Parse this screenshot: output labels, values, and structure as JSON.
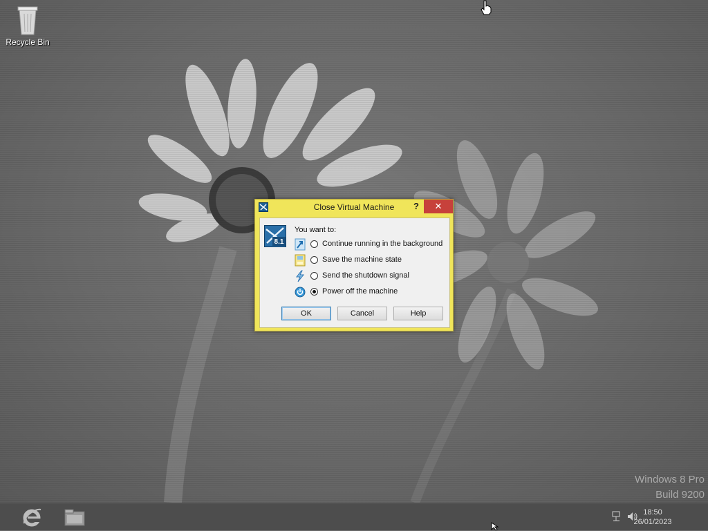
{
  "desktop": {
    "icons": [
      {
        "label": "Recycle Bin",
        "icon": "recycle-bin-icon"
      }
    ],
    "watermark": {
      "line1": "Windows 8 Pro",
      "line2": "Build 9200"
    }
  },
  "dialog": {
    "title": "Close Virtual Machine",
    "help_glyph": "?",
    "close_glyph": "✕",
    "logo_text": "8.1",
    "prompt": "You want to:",
    "options": [
      {
        "label": "Continue running in the background",
        "icon": "continue-running-icon",
        "checked": false
      },
      {
        "label": "Save the machine state",
        "icon": "save-state-icon",
        "checked": false
      },
      {
        "label": "Send the shutdown signal",
        "icon": "shutdown-signal-icon",
        "checked": false
      },
      {
        "label": "Power off the machine",
        "icon": "power-off-icon",
        "checked": true
      }
    ],
    "buttons": {
      "ok": "OK",
      "cancel": "Cancel",
      "help": "Help"
    },
    "colors": {
      "frame": "#f0e55a",
      "close": "#c7413b"
    }
  },
  "taskbar": {
    "pinned": [
      {
        "name": "internet-explorer",
        "icon": "internet-explorer-icon"
      },
      {
        "name": "file-explorer",
        "icon": "file-explorer-icon"
      }
    ],
    "tray": {
      "network": "network-icon",
      "volume": "volume-icon"
    },
    "clock": {
      "time": "18:50",
      "date": "26/01/2023"
    }
  }
}
